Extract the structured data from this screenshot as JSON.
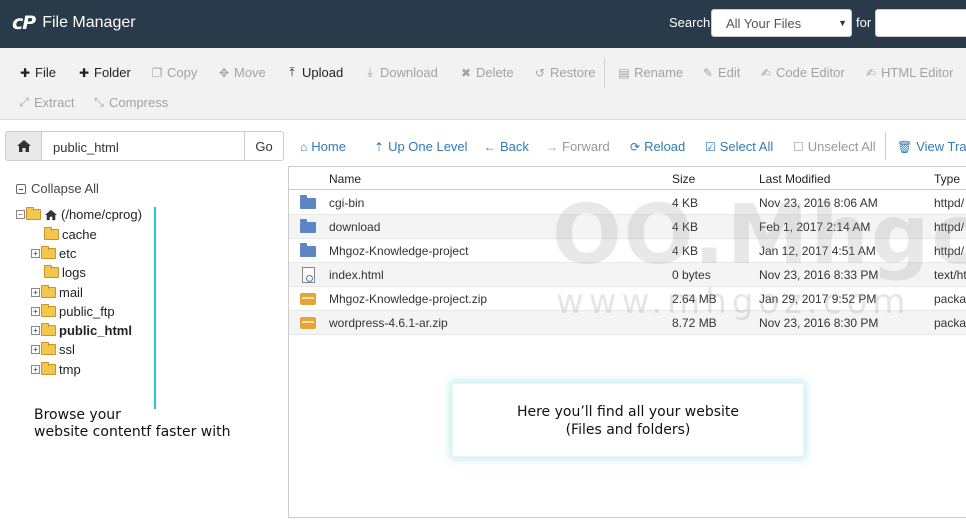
{
  "header": {
    "logo": "cP",
    "title": "File Manager",
    "search_label": "Search",
    "search_scope": "All Your Files",
    "for_label": "for",
    "search_value": ""
  },
  "toolbar": {
    "row1": [
      {
        "label": "File",
        "icon": "plus-icon",
        "enabled": true
      },
      {
        "label": "Folder",
        "icon": "plus-icon",
        "enabled": true
      },
      {
        "label": "Copy",
        "icon": "copy-icon",
        "enabled": false
      },
      {
        "label": "Move",
        "icon": "move-icon",
        "enabled": false
      },
      {
        "label": "Upload",
        "icon": "upload-icon",
        "enabled": true
      },
      {
        "label": "Download",
        "icon": "download-icon",
        "enabled": false
      },
      {
        "label": "Delete",
        "icon": "times-icon",
        "enabled": false
      },
      {
        "label": "Restore",
        "icon": "undo-icon",
        "enabled": false
      },
      {
        "label": "Rename",
        "icon": "file-icon",
        "enabled": false
      },
      {
        "label": "Edit",
        "icon": "pencil-icon",
        "enabled": false
      },
      {
        "label": "Code Editor",
        "icon": "edit-icon",
        "enabled": false
      },
      {
        "label": "HTML Editor",
        "icon": "edit-icon",
        "enabled": false
      }
    ],
    "row2": [
      {
        "label": "Extract",
        "icon": "expand-icon",
        "enabled": false
      },
      {
        "label": "Compress",
        "icon": "compress-icon",
        "enabled": false
      }
    ]
  },
  "path": {
    "value": "public_html",
    "go_label": "Go"
  },
  "nav": [
    {
      "label": "Home",
      "icon": "home-icon",
      "enabled": true
    },
    {
      "label": "Up One Level",
      "icon": "level-up-icon",
      "enabled": true
    },
    {
      "label": "Back",
      "icon": "arrow-left-icon",
      "enabled": true
    },
    {
      "label": "Forward",
      "icon": "arrow-right-icon",
      "enabled": false
    },
    {
      "label": "Reload",
      "icon": "refresh-icon",
      "enabled": true
    },
    {
      "label": "Select All",
      "icon": "check-square-icon",
      "enabled": true
    },
    {
      "label": "Unselect All",
      "icon": "square-icon",
      "enabled": false
    },
    {
      "label": "View Trash",
      "icon": "trash-icon",
      "enabled": true
    }
  ],
  "tree": {
    "collapse_label": "Collapse All",
    "root": "(/home/cprog)",
    "items": [
      {
        "label": "cache",
        "expandable": false,
        "bold": false
      },
      {
        "label": "etc",
        "expandable": true,
        "bold": false
      },
      {
        "label": "logs",
        "expandable": false,
        "bold": false
      },
      {
        "label": "mail",
        "expandable": true,
        "bold": false
      },
      {
        "label": "public_ftp",
        "expandable": true,
        "bold": false
      },
      {
        "label": "public_html",
        "expandable": true,
        "bold": true
      },
      {
        "label": "ssl",
        "expandable": true,
        "bold": false
      },
      {
        "label": "tmp",
        "expandable": true,
        "bold": false
      }
    ],
    "note_line1": "Browse your",
    "note_line2": "website contentf faster with"
  },
  "table": {
    "columns": [
      "Name",
      "Size",
      "Last Modified",
      "Type"
    ],
    "rows": [
      {
        "name": "cgi-bin",
        "size": "4 KB",
        "modified": "Nov 23, 2016 8:06 AM",
        "type": "httpd/",
        "kind": "dir"
      },
      {
        "name": "download",
        "size": "4 KB",
        "modified": "Feb 1, 2017 2:14 AM",
        "type": "httpd/",
        "kind": "dir"
      },
      {
        "name": "Mhgoz-Knowledge-project",
        "size": "4 KB",
        "modified": "Jan 12, 2017 4:51 AM",
        "type": "httpd/",
        "kind": "dir"
      },
      {
        "name": "index.html",
        "size": "0 bytes",
        "modified": "Nov 23, 2016 8:33 PM",
        "type": "text/ht",
        "kind": "doc"
      },
      {
        "name": "Mhgoz-Knowledge-project.zip",
        "size": "2.64 MB",
        "modified": "Jan 29, 2017 9:52 PM",
        "type": "packa",
        "kind": "zip"
      },
      {
        "name": "wordpress-4.6.1-ar.zip",
        "size": "8.72 MB",
        "modified": "Nov 23, 2016 8:30 PM",
        "type": "packa",
        "kind": "zip"
      }
    ]
  },
  "info": {
    "line1": "Here you’ll find all your website",
    "line2": "(Files and folders)"
  },
  "watermark": {
    "logo": "OO.Mhgoz",
    "url": "www.mhgoz.com"
  }
}
